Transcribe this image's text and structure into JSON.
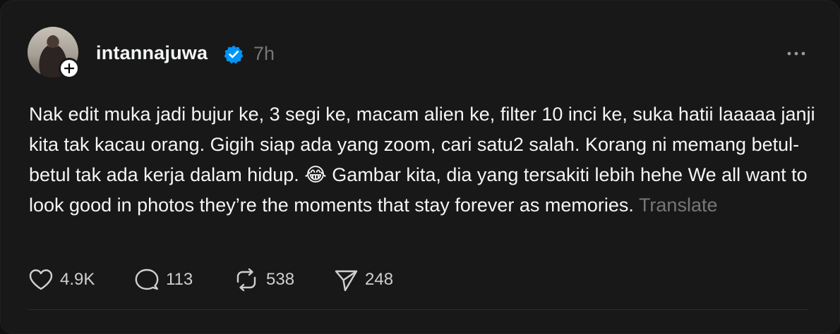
{
  "post": {
    "username": "intannajuwa",
    "time": "7h",
    "text": "Nak edit muka jadi bujur ke, 3 segi ke, macam alien ke, filter 10 inci ke, suka hatii laaaaa janji kita tak kacau orang. Gigih siap ada yang zoom, cari satu2 salah. Korang ni memang betul-betul tak ada kerja dalam hidup. 😂 Gambar kita, dia yang tersakiti lebih hehe We all want to look good in photos they’re the moments that stay forever as memories. ",
    "translate_label": "Translate",
    "accent_color": "#0095f6"
  },
  "actions": {
    "likes": "4.9K",
    "replies": "113",
    "reposts": "538",
    "shares": "248"
  },
  "icons": {
    "like": "heart-icon",
    "reply": "comment-bubble-icon",
    "repost": "repost-icon",
    "share": "send-icon",
    "more": "more-dots-icon",
    "verified": "verified-badge-icon",
    "follow": "plus-icon"
  }
}
